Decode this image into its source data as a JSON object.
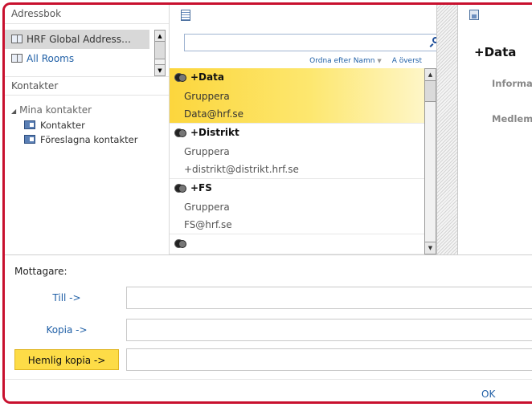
{
  "left": {
    "address_book_header": "Adressbok",
    "address_books": [
      {
        "label": "HRF Global Address…",
        "selected": true
      },
      {
        "label": "All Rooms",
        "selected": false
      }
    ],
    "contacts_header": "Kontakter",
    "tree": {
      "root": "Mina kontakter",
      "items": [
        "Kontakter",
        "Föreslagna kontakter"
      ]
    }
  },
  "middle": {
    "search": {
      "value": "",
      "placeholder": ""
    },
    "sort_label": "Ordna efter Namn",
    "top_link": "A överst",
    "results": [
      {
        "name": "+Data",
        "type": "Gruppera",
        "email": "Data@hrf.se",
        "selected": true
      },
      {
        "name": "+Distrikt",
        "type": "Gruppera",
        "email": "+distrikt@distrikt.hrf.se",
        "selected": false
      },
      {
        "name": "+FS",
        "type": "Gruppera",
        "email": "FS@hrf.se",
        "selected": false
      }
    ]
  },
  "details": {
    "title": "+Data",
    "info_label": "Informat",
    "members_label": "Medlem"
  },
  "recipients": {
    "header": "Mottagare:",
    "to_label": "Till ->",
    "cc_label": "Kopia ->",
    "bcc_label": "Hemlig kopia ->",
    "to_value": "",
    "cc_value": "",
    "bcc_value": ""
  },
  "footer": {
    "ok_label": "OK"
  },
  "colors": {
    "frame": "#c8102e",
    "selection": "#fcd63d",
    "link": "#1f5fa6"
  }
}
